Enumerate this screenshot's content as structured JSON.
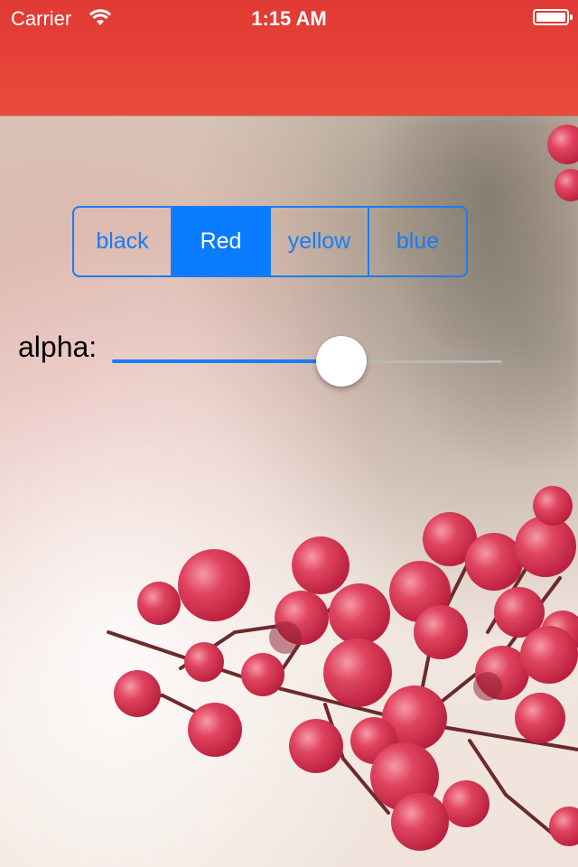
{
  "status_bar": {
    "carrier": "Carrier",
    "time": "1:15 AM"
  },
  "segmented_control": {
    "segments": [
      "black",
      "Red",
      "yellow",
      "blue"
    ],
    "selected": "Red"
  },
  "alpha_slider": {
    "label": "alpha:",
    "value": 0.6
  },
  "colors": {
    "nav_bar": "#e64238",
    "tint": "#1a7cf6",
    "berry": "#d8304e"
  },
  "icons": [
    "wifi-icon",
    "battery-icon"
  ]
}
